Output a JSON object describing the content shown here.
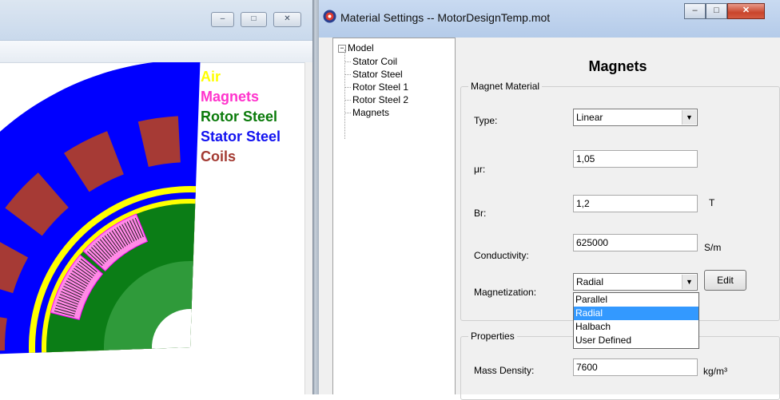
{
  "left_window": {
    "caption_buttons": {
      "minimize": "–",
      "maximize": "□",
      "close": "✕"
    },
    "legend": [
      {
        "label": "Air",
        "color": "#ffff00"
      },
      {
        "label": "Magnets",
        "color": "#ff33cc"
      },
      {
        "label": "Rotor Steel",
        "color": "#0a7a0a"
      },
      {
        "label": "Stator Steel",
        "color": "#1212f0"
      },
      {
        "label": "Coils",
        "color": "#a33a32"
      }
    ],
    "colors": {
      "air": "#ffff00",
      "magnet": "#ff8ae6",
      "magnet_outline": "#ff00ff",
      "rotor": "#0b7d16",
      "rotor_inner": "#2f9a3a",
      "stator": "#0000ff",
      "coil": "#a63a35"
    }
  },
  "right_window": {
    "title": "Material Settings -- MotorDesignTemp.mot",
    "icon": "app-icon",
    "tree": {
      "root": "Model",
      "items": [
        "Stator Coil",
        "Stator Steel",
        "Rotor Steel 1",
        "Rotor Steel 2",
        "Magnets"
      ]
    },
    "heading": "Magnets",
    "magnet_material": {
      "group_title": "Magnet Material",
      "type_label": "Type:",
      "type_value": "Linear",
      "mur_label": "μr:",
      "mur_value": "1,05",
      "br_label": "Br:",
      "br_value": "1,2",
      "br_unit": "T",
      "conductivity_label": "Conductivity:",
      "conductivity_value": "625000",
      "conductivity_unit": "S/m",
      "magnetization_label": "Magnetization:",
      "magnetization_value": "Radial",
      "edit_label": "Edit"
    },
    "magnetization_options": [
      "Parallel",
      "Radial",
      "Halbach",
      "User Defined"
    ],
    "magnetization_selected": "Radial",
    "properties": {
      "group_title": "Properties",
      "mass_density_label": "Mass Density:",
      "mass_density_value": "7600",
      "mass_density_unit": "kg/m³"
    }
  }
}
